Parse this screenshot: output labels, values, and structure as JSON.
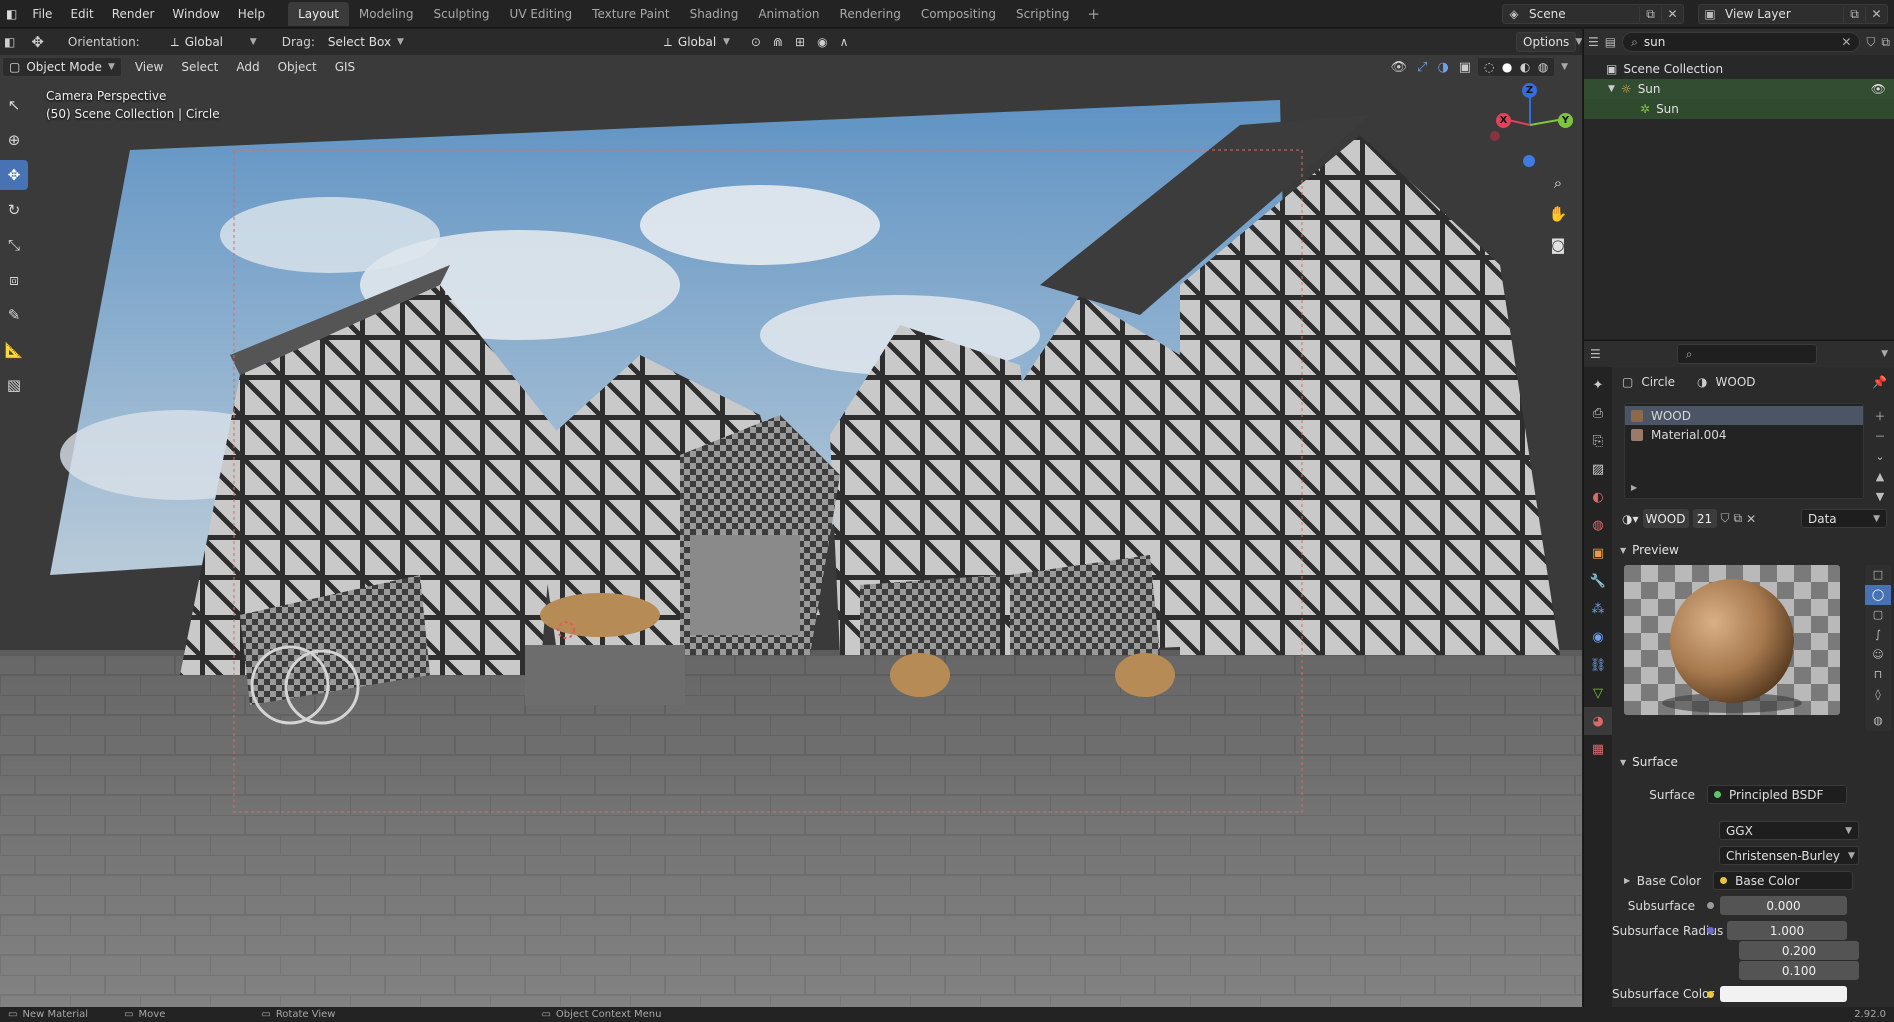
{
  "menu": [
    "File",
    "Edit",
    "Render",
    "Window",
    "Help"
  ],
  "workspaces": [
    {
      "label": "Layout",
      "active": true
    },
    {
      "label": "Modeling",
      "active": false
    },
    {
      "label": "Sculpting",
      "active": false
    },
    {
      "label": "UV Editing",
      "active": false
    },
    {
      "label": "Texture Paint",
      "active": false
    },
    {
      "label": "Shading",
      "active": false
    },
    {
      "label": "Animation",
      "active": false
    },
    {
      "label": "Rendering",
      "active": false
    },
    {
      "label": "Compositing",
      "active": false
    },
    {
      "label": "Scripting",
      "active": false
    }
  ],
  "scene": {
    "name": "Scene",
    "view_layer": "View Layer"
  },
  "toolbar": {
    "orientation_label": "Orientation:",
    "orientation_value": "Global",
    "drag_label": "Drag:",
    "drag_value": "Select Box",
    "transform_orientation": "Global",
    "options_label": "Options"
  },
  "viewport": {
    "mode": "Object Mode",
    "menus": [
      "View",
      "Select",
      "Add",
      "Object",
      "GIS"
    ],
    "info_line1": "Camera Perspective",
    "info_line2": "(50) Scene Collection | Circle",
    "gizmo": {
      "x": "X",
      "y": "Y",
      "z": "Z"
    }
  },
  "outliner": {
    "search": "sun",
    "rows": [
      {
        "label": "Scene Collection",
        "icon": "collection-icon"
      },
      {
        "label": "Sun",
        "icon": "light-object-icon"
      },
      {
        "label": "Sun",
        "icon": "sun-data-icon"
      }
    ]
  },
  "properties": {
    "object_name": "Circle",
    "material_name": "WOOD",
    "slots": [
      {
        "label": "WOOD",
        "color": "#8a6a4a",
        "active": true
      },
      {
        "label": "Material.004",
        "color": "#9a7b6a",
        "active": false
      }
    ],
    "material_field": "WOOD",
    "user_count": "21",
    "link_value": "Data",
    "preview_title": "Preview",
    "surface_title": "Surface",
    "surface_label": "Surface",
    "surface_value": "Principled BSDF",
    "distribution": "GGX",
    "subsurface_method": "Christensen-Burley",
    "base_color_label": "Base Color",
    "base_color_value": "Base Color",
    "subsurface_label": "Subsurface",
    "subsurface_value": "0.000",
    "subsurface_radius_label": "Subsurface Radius",
    "subsurface_radius": [
      "1.000",
      "0.200",
      "0.100"
    ],
    "subsurface_color_label": "Subsurface Color"
  },
  "statusbar": {
    "items": [
      "New Material",
      "Move",
      "Rotate View",
      "Object Context Menu"
    ],
    "version": "2.92.0"
  },
  "colors": {
    "accent": "#4772b3",
    "outliner_selected": "#334d33",
    "sky": "#4a7fb5",
    "floor": "#6e6e6e"
  }
}
